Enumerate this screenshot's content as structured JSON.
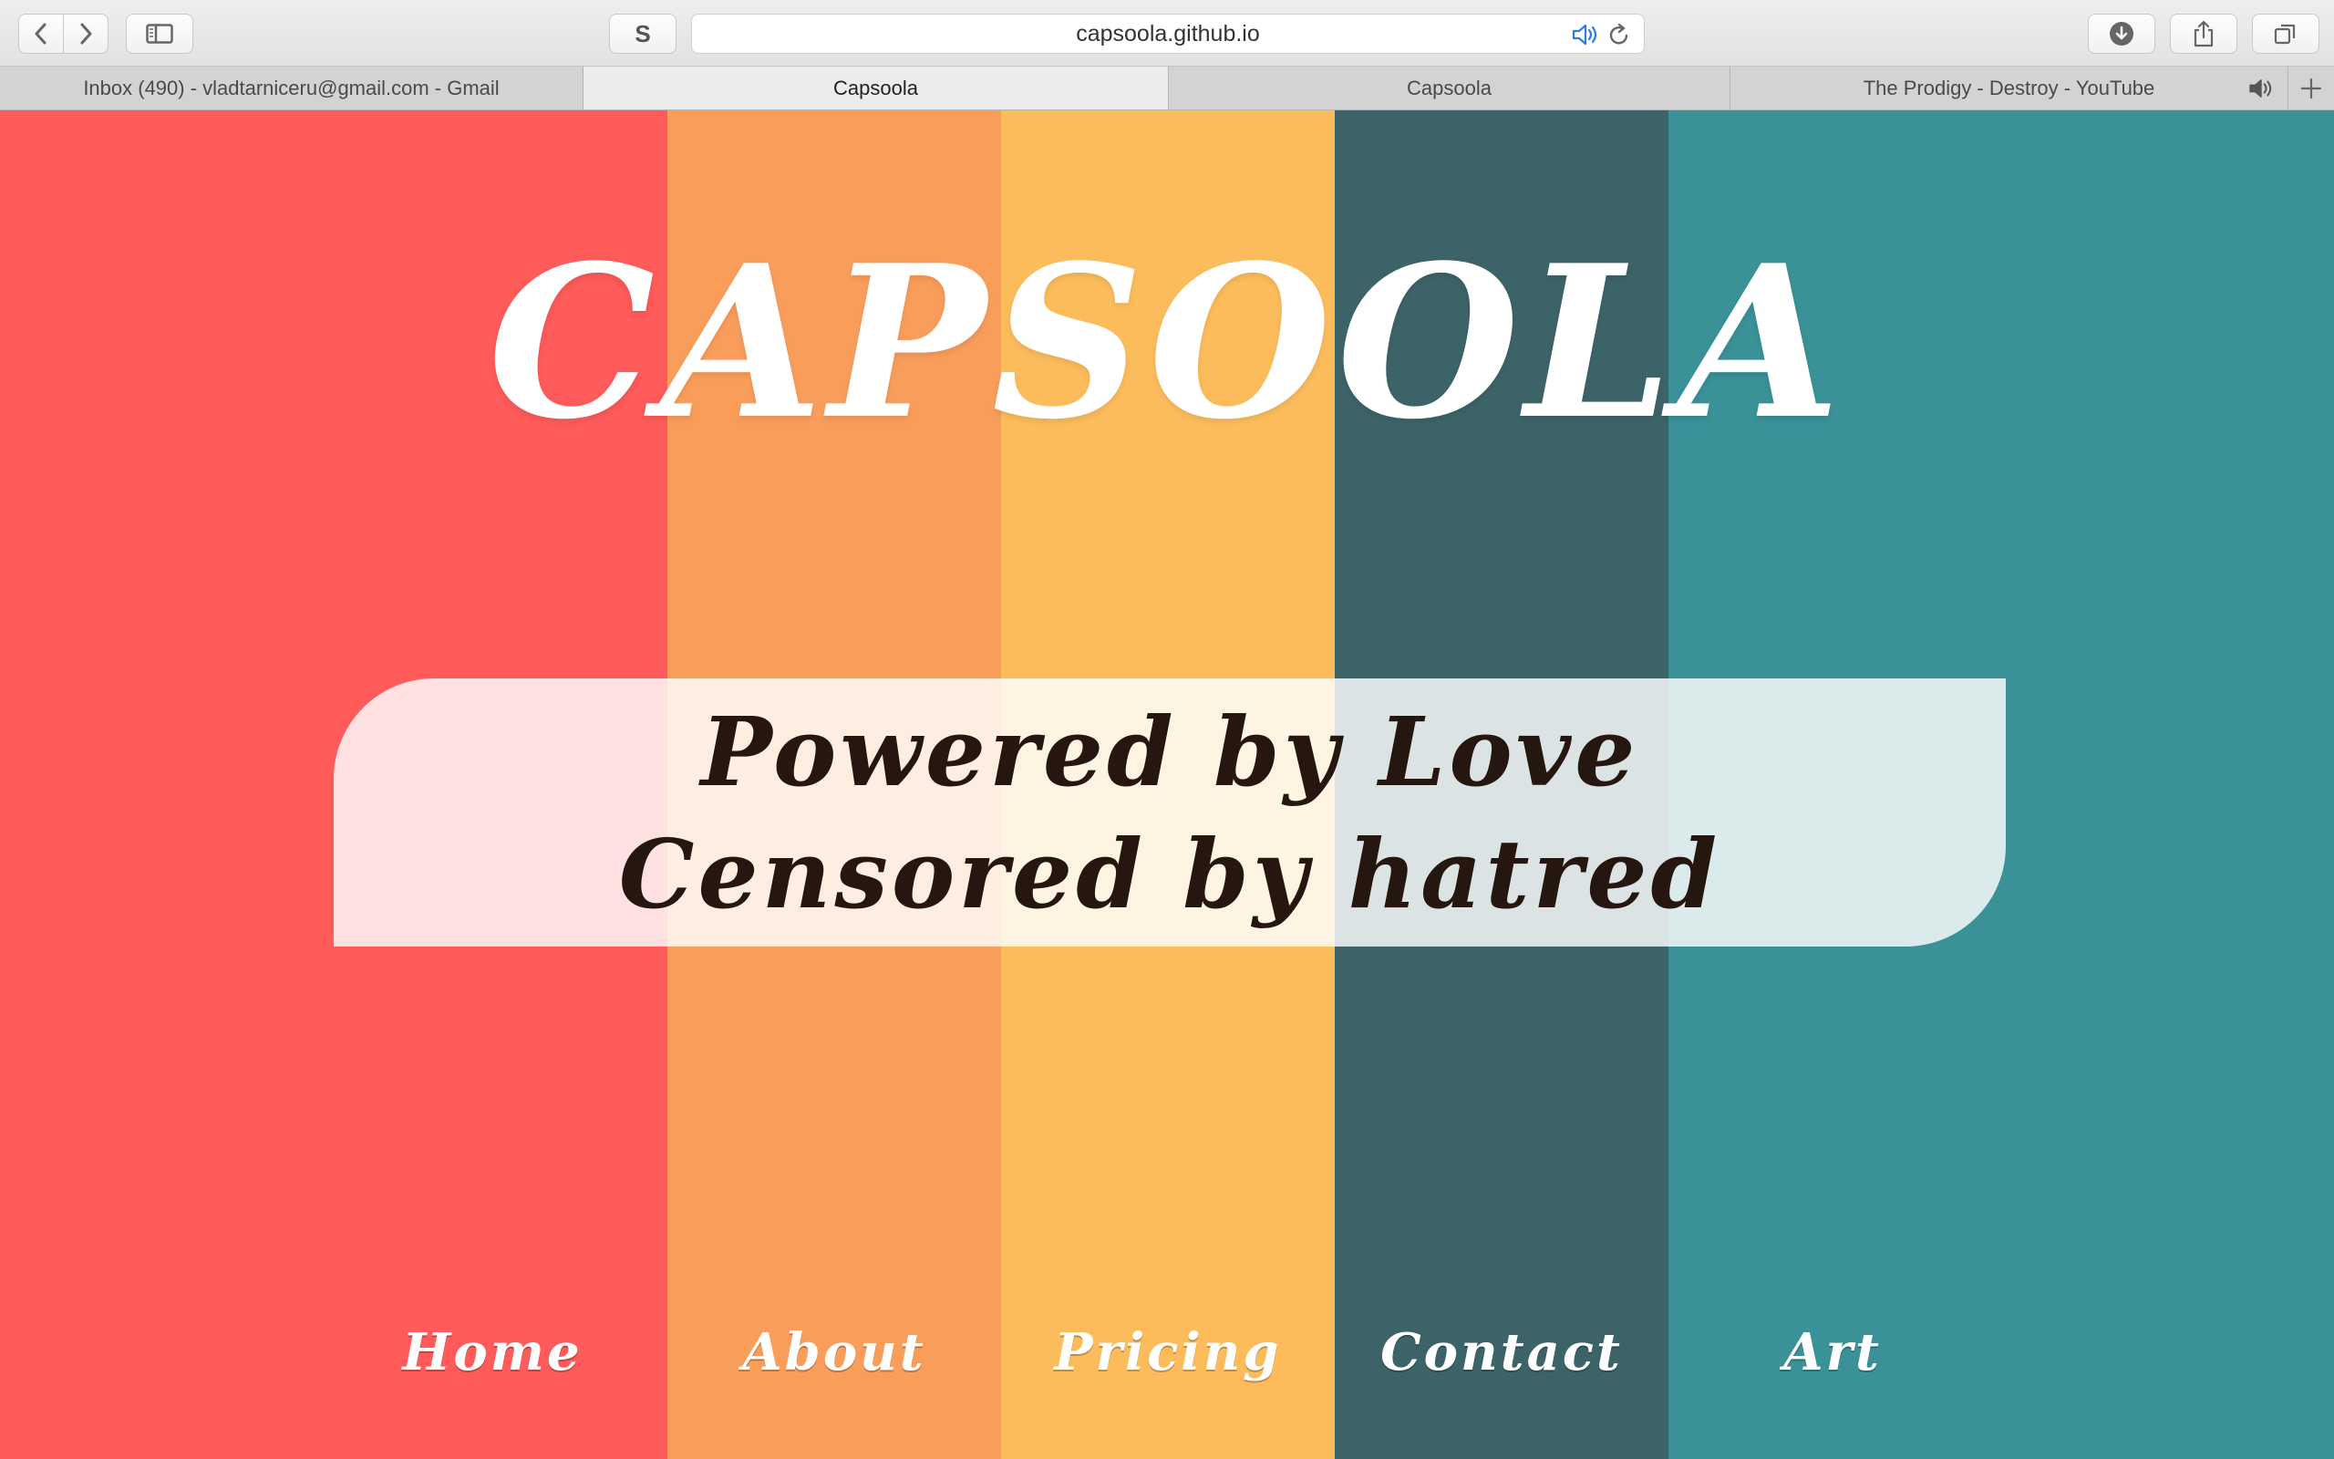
{
  "browser": {
    "url": "capsoola.github.io",
    "reader_label": "S",
    "tabs": [
      {
        "title": "Inbox (490) - vladtarniceru@gmail.com - Gmail",
        "active": false
      },
      {
        "title": "Capsoola",
        "active": true
      },
      {
        "title": "Capsoola",
        "active": false
      },
      {
        "title": "The Prodigy - Destroy - YouTube",
        "active": false,
        "audio": true
      }
    ],
    "icons": {
      "back": "chevron-left-icon",
      "forward": "chevron-right-icon",
      "sidebar": "sidebar-icon",
      "audio": "speaker-icon",
      "reload": "reload-icon",
      "download": "download-icon",
      "share": "share-icon",
      "tabs": "tab-overview-icon",
      "new_tab": "plus-icon"
    }
  },
  "page": {
    "brand": "CAPSOOLA",
    "tagline": {
      "line1": "Powered by Love",
      "line2": "Censored by hatred"
    },
    "nav": [
      "Home",
      "About",
      "Pricing",
      "Contact",
      "Art"
    ],
    "colors": {
      "stripe1": "#fe5b5a",
      "stripe2": "#f99d5b",
      "stripe3": "#fcbc5c",
      "stripe4": "#3c6468",
      "stripe5": "#3a9198",
      "text_light": "#ffffff",
      "text_dark": "#25160f"
    }
  }
}
